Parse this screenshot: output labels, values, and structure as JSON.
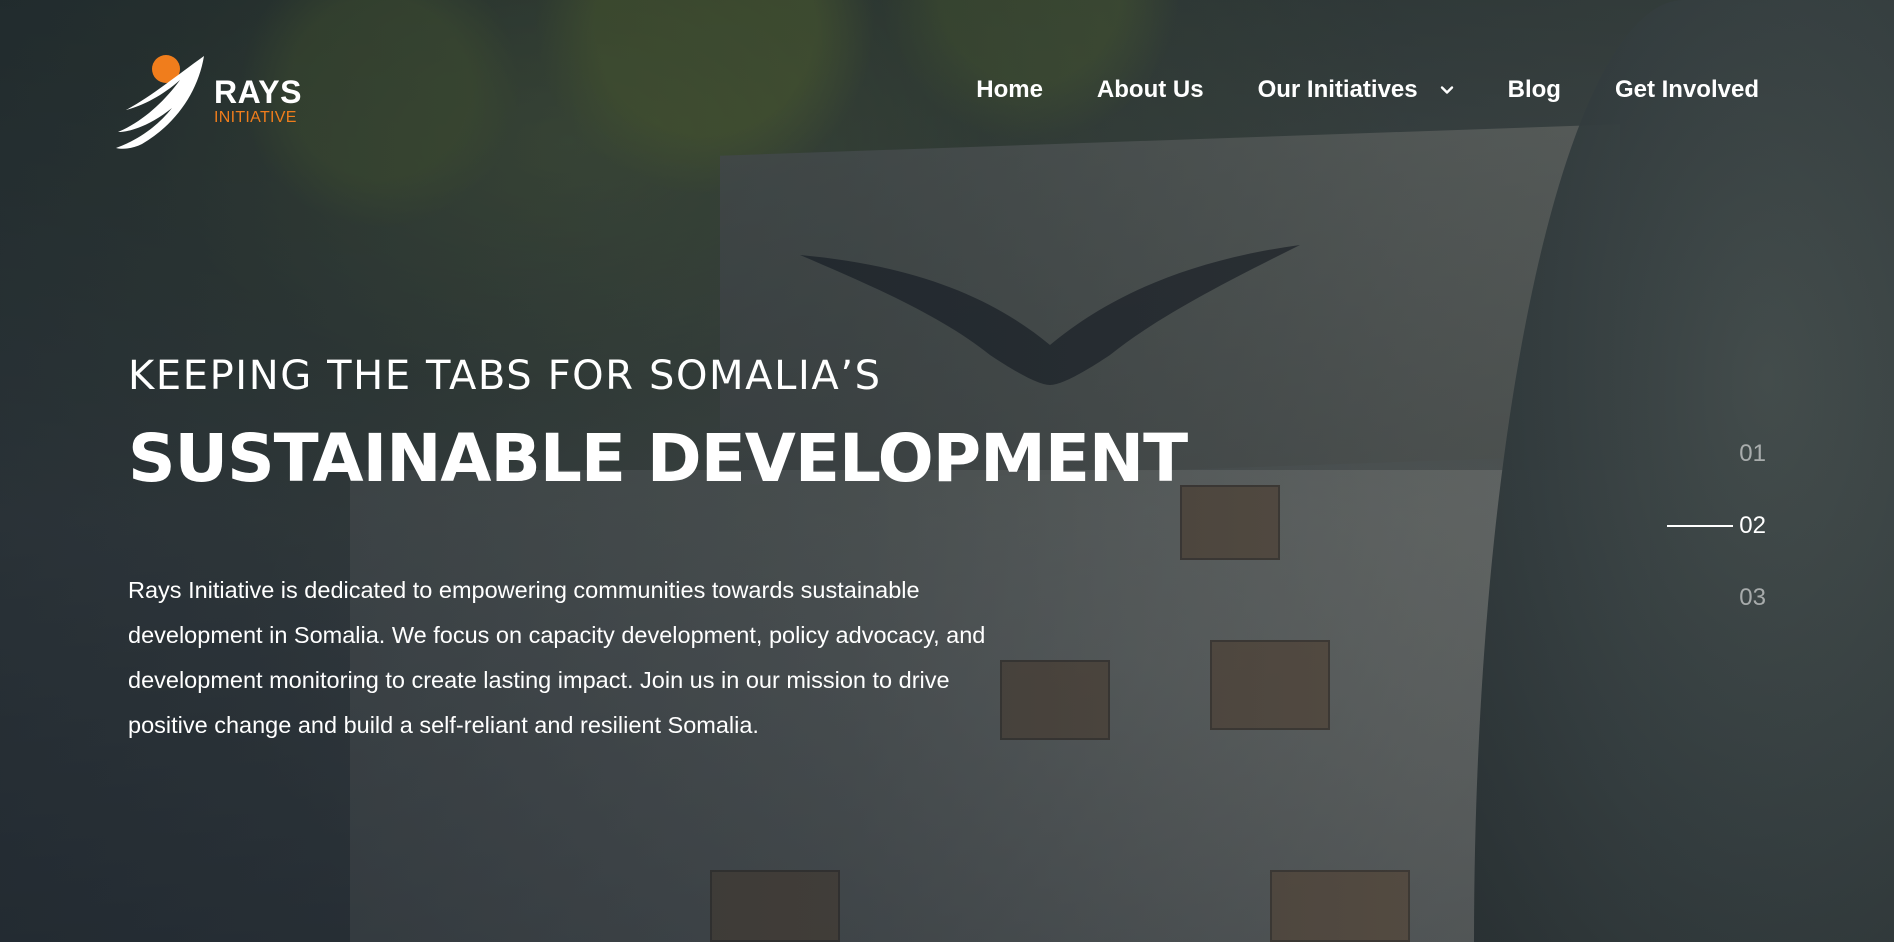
{
  "brand": {
    "name": "RAYS",
    "subtitle": "INITIATIVE",
    "accent_color": "#f07d1c",
    "logo_icon": "wing-sun-logo-icon"
  },
  "nav": {
    "items": [
      {
        "label": "Home"
      },
      {
        "label": "About Us"
      },
      {
        "label": "Our Initiatives",
        "has_dropdown": true,
        "icon": "chevron-down-icon"
      },
      {
        "label": "Blog"
      },
      {
        "label": "Get Involved"
      }
    ]
  },
  "hero": {
    "kicker": "KEEPING THE TABS FOR SOMALIA’S",
    "headline": "SUSTAINABLE DEVELOPMENT",
    "description": "Rays Initiative is dedicated to empowering communities towards sustainable development in Somalia. We focus on capacity development, policy advocacy, and development monitoring to create lasting impact. Join us in our mission to drive positive change and build a self-reliant and resilient Somalia."
  },
  "slider": {
    "items": [
      {
        "label": "01"
      },
      {
        "label": "02"
      },
      {
        "label": "03"
      }
    ],
    "active_index": 1
  }
}
